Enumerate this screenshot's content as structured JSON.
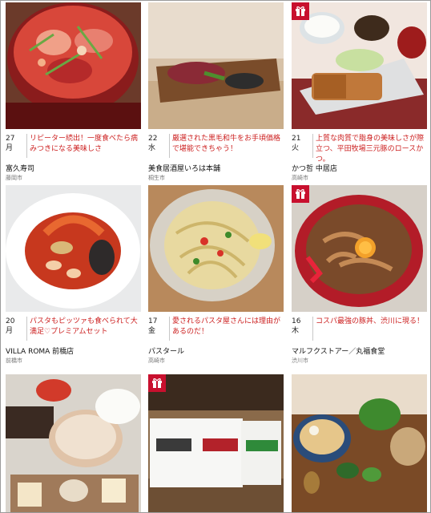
{
  "cards": [
    {
      "day": "27",
      "weekday": "月",
      "title": "リピーター続出！一度食べたら病みつきになる美味しさ",
      "shop": "富久寿司",
      "city": "藤岡市",
      "gift": false
    },
    {
      "day": "22",
      "weekday": "水",
      "title": "厳選された黒毛和牛をお手頃価格で堪能できちゃう！",
      "shop": "美食居酒屋いろは本舗",
      "city": "桐生市",
      "gift": false
    },
    {
      "day": "21",
      "weekday": "火",
      "title": "上質な肉質で脂身の美味しさが際立つ、平田牧場三元豚のロースかつ。",
      "shop": "かつ哲 中居店",
      "city": "高崎市",
      "gift": true
    },
    {
      "day": "20",
      "weekday": "月",
      "title": "パスタもピッツァも食べられて大満足♡プレミアムセット",
      "shop": "VILLA ROMA 前橋店",
      "city": "前橋市",
      "gift": false
    },
    {
      "day": "17",
      "weekday": "金",
      "title": "愛されるパスタ屋さんには理由があるのだ！",
      "shop": "パスタール",
      "city": "高崎市",
      "gift": false
    },
    {
      "day": "16",
      "weekday": "木",
      "title": "コスパ最強の豚丼、渋川に現る！",
      "shop": "マルフクストアー／丸福食堂",
      "city": "渋川市",
      "gift": true
    },
    {
      "gift": false
    },
    {
      "gift": true
    },
    {
      "gift": false
    }
  ],
  "colors": {
    "accent": "#cc1f1f",
    "gift": "#c8102e"
  },
  "icons": {
    "gift": "gift-icon"
  }
}
